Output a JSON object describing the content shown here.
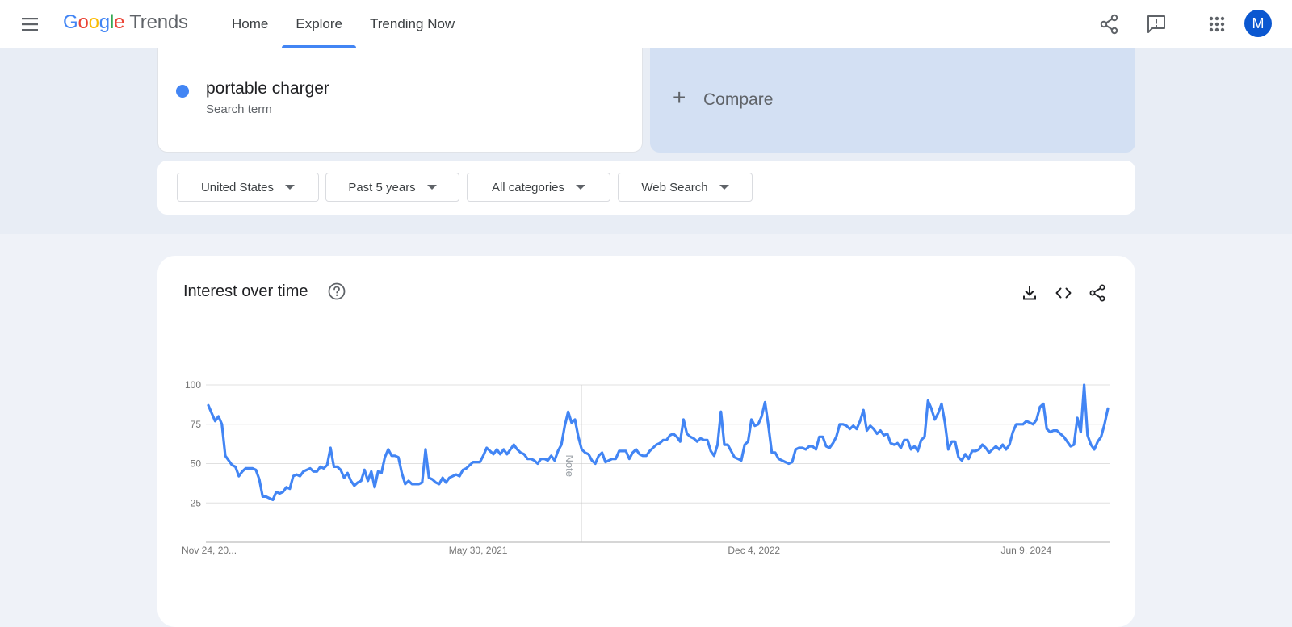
{
  "header": {
    "logo_google": "Google",
    "logo_trends": "Trends",
    "nav": [
      "Home",
      "Explore",
      "Trending Now"
    ],
    "active_nav": "Explore",
    "avatar_letter": "M"
  },
  "search": {
    "term": "portable charger",
    "term_sub": "Search term",
    "compare_label": "Compare",
    "term_color": "#4285f4"
  },
  "filters": [
    "United States",
    "Past 5 years",
    "All categories",
    "Web Search"
  ],
  "chart_section": {
    "title": "Interest over time",
    "note_label": "Note"
  },
  "chart_data": {
    "type": "line",
    "title": "Interest over time",
    "xlabel": "",
    "ylabel": "",
    "ylim": [
      0,
      100
    ],
    "yticks": [
      25,
      50,
      75,
      100
    ],
    "x_tick_labels": [
      "Nov 24, 20...",
      "May 30, 2021",
      "Dec 4, 2022",
      "Jun 9, 2024"
    ],
    "grid": true,
    "series_color": "#4285f4",
    "series": [
      {
        "name": "portable charger",
        "values": [
          87,
          82,
          77,
          80,
          75,
          55,
          52,
          49,
          48,
          42,
          45,
          47,
          47,
          47,
          46,
          40,
          29,
          29,
          28,
          27,
          32,
          31,
          32,
          35,
          34,
          42,
          43,
          42,
          45,
          46,
          47,
          45,
          45,
          48,
          47,
          49,
          60,
          48,
          48,
          46,
          41,
          44,
          39,
          36,
          38,
          39,
          46,
          39,
          45,
          35,
          45,
          44,
          54,
          59,
          55,
          55,
          54,
          44,
          37,
          39,
          37,
          37,
          37,
          38,
          59,
          41,
          40,
          38,
          37,
          41,
          38,
          41,
          42,
          43,
          42,
          46,
          47,
          49,
          51,
          51,
          51,
          55,
          60,
          58,
          56,
          59,
          56,
          59,
          56,
          59,
          62,
          59,
          57,
          56,
          53,
          53,
          52,
          50,
          53,
          53,
          52,
          55,
          52,
          58,
          62,
          74,
          83,
          76,
          78,
          67,
          59,
          57,
          56,
          52,
          50,
          55,
          57,
          51,
          52,
          53,
          53,
          58,
          58,
          58,
          53,
          57,
          59,
          56,
          55,
          55,
          58,
          60,
          62,
          63,
          65,
          65,
          68,
          69,
          67,
          64,
          78,
          69,
          67,
          66,
          64,
          66,
          65,
          65,
          58,
          55,
          62,
          83,
          62,
          62,
          58,
          54,
          53,
          52,
          62,
          64,
          78,
          74,
          75,
          80,
          89,
          74,
          57,
          57,
          53,
          52,
          51,
          50,
          51,
          59,
          60,
          60,
          59,
          61,
          61,
          59,
          67,
          67,
          61,
          60,
          63,
          67,
          75,
          75,
          74,
          72,
          74,
          72,
          77,
          84,
          71,
          74,
          72,
          69,
          71,
          68,
          69,
          63,
          62,
          63,
          60,
          65,
          65,
          59,
          61,
          58,
          65,
          67,
          90,
          85,
          78,
          82,
          88,
          76,
          59,
          64,
          64,
          54,
          52,
          56,
          53,
          58,
          58,
          59,
          62,
          60,
          57,
          59,
          61,
          59,
          62,
          59,
          62,
          70,
          75,
          75,
          75,
          77,
          76,
          75,
          78,
          86,
          88,
          72,
          70,
          71,
          71,
          69,
          67,
          64,
          61,
          62,
          79,
          70,
          100,
          68,
          62,
          59,
          64,
          67,
          75,
          85
        ]
      }
    ]
  }
}
